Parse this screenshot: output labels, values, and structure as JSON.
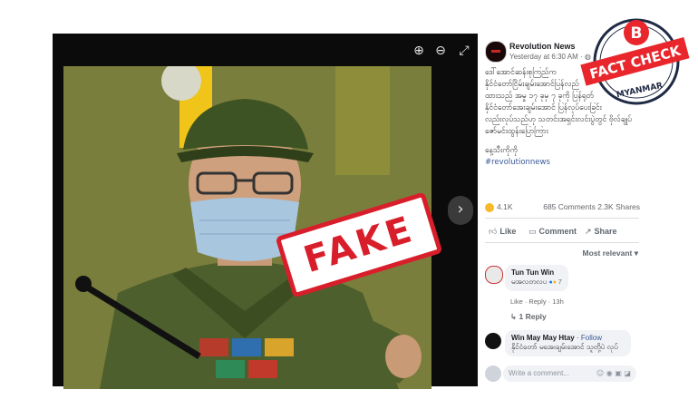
{
  "viewer": {
    "stamp_text": "FAKE",
    "zoom_in_icon": "zoom-in-icon",
    "zoom_out_icon": "zoom-out-icon",
    "fullscreen_icon": "fullscreen-icon",
    "next_icon": "chevron-right-icon"
  },
  "post": {
    "page_name": "Revolution News",
    "timestamp": "Yesterday at 6:30 AM",
    "text_lines": [
      "ဒေါ်အောင်ဆန်းစုကြည်က",
      "နိုင်ငံတော်ငြိမ်းချမ်းအောင်ပြန်လည်",
      "ထားသည် အမှု ၁၇ ခုမှ ၇ ခုကို ပြန်ရုတ်",
      "နိုင်ငံတော်အေးချမ်းအောင် ပြန်လုပ်ပေးခြင်း",
      "လည်းလုပ်သည်ဟု သတင်းအရှင်းလင်းပွဲတွင် ဗိုလ်ချုပ်",
      "ဇော်မင်းထွန်းပြောကြား"
    ],
    "signature": "နေ့သီးကိုကို",
    "hashtag": "#revolutionnews",
    "reaction_count": "4.1K",
    "comments_shares": "685 Comments  2.3K Shares",
    "like_label": "Like",
    "comment_label": "Comment",
    "share_label": "Share",
    "sort_label": "Most relevant"
  },
  "comments": [
    {
      "name": "Tun Tun Win",
      "text": "မအလတလပ",
      "reaction_count": "7",
      "meta": "Like · Reply · 13h",
      "replies": "1 Reply"
    },
    {
      "name": "Win May May Htay",
      "follow": "· Follow",
      "text": "နိုင်ငံတော် မအေးချမ်းအောင် သူတို့ပဲ လုပ်"
    }
  ],
  "composer": {
    "placeholder": "Write a comment..."
  },
  "badge": {
    "letter": "B",
    "line1": "FACT CHECK",
    "line2": "MYANMAR",
    "accent": "#e8262c"
  }
}
